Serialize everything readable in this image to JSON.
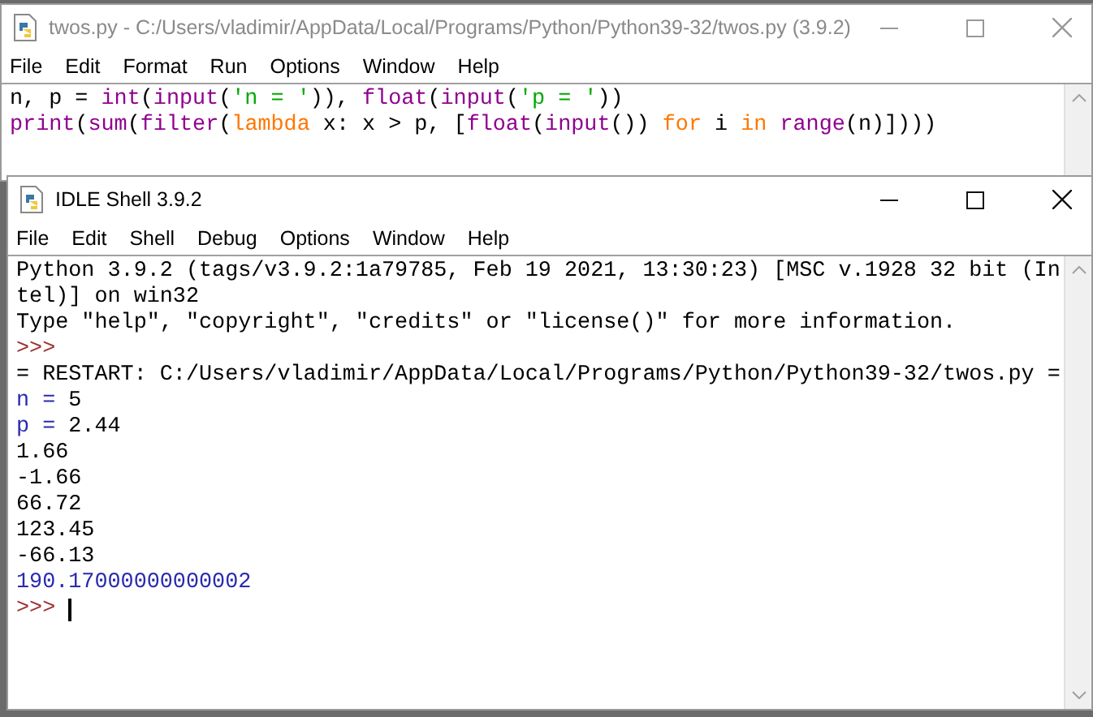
{
  "editor": {
    "title": "twos.py - C:/Users/vladimir/AppData/Local/Programs/Python/Python39-32/twos.py (3.9.2)",
    "active": false,
    "menu": [
      "File",
      "Edit",
      "Format",
      "Run",
      "Options",
      "Window",
      "Help"
    ],
    "lines": [
      [
        {
          "text": "n, p = ",
          "kind": "plain"
        },
        {
          "text": "int",
          "kind": "builtin"
        },
        {
          "text": "(",
          "kind": "plain"
        },
        {
          "text": "input",
          "kind": "builtin"
        },
        {
          "text": "(",
          "kind": "plain"
        },
        {
          "text": "'n = '",
          "kind": "string"
        },
        {
          "text": ")), ",
          "kind": "plain"
        },
        {
          "text": "float",
          "kind": "builtin"
        },
        {
          "text": "(",
          "kind": "plain"
        },
        {
          "text": "input",
          "kind": "builtin"
        },
        {
          "text": "(",
          "kind": "plain"
        },
        {
          "text": "'p = '",
          "kind": "string"
        },
        {
          "text": "))",
          "kind": "plain"
        }
      ],
      [
        {
          "text": "print",
          "kind": "builtin"
        },
        {
          "text": "(",
          "kind": "plain"
        },
        {
          "text": "sum",
          "kind": "builtin"
        },
        {
          "text": "(",
          "kind": "plain"
        },
        {
          "text": "filter",
          "kind": "builtin"
        },
        {
          "text": "(",
          "kind": "plain"
        },
        {
          "text": "lambda",
          "kind": "keyword"
        },
        {
          "text": " x: x > p, [",
          "kind": "plain"
        },
        {
          "text": "float",
          "kind": "builtin"
        },
        {
          "text": "(",
          "kind": "plain"
        },
        {
          "text": "input",
          "kind": "builtin"
        },
        {
          "text": "()) ",
          "kind": "plain"
        },
        {
          "text": "for",
          "kind": "keyword"
        },
        {
          "text": " i ",
          "kind": "plain"
        },
        {
          "text": "in",
          "kind": "keyword"
        },
        {
          "text": " range",
          "kind": "builtin"
        },
        {
          "text": "(n)])))",
          "kind": "plain"
        }
      ]
    ]
  },
  "shell": {
    "title": "IDLE Shell 3.9.2",
    "active": true,
    "menu": [
      "File",
      "Edit",
      "Shell",
      "Debug",
      "Options",
      "Window",
      "Help"
    ],
    "lines": [
      [
        {
          "text": "Python 3.9.2 (tags/v3.9.2:1a79785, Feb 19 2021, 13:30:23) [MSC v.1928 32 bit (In",
          "kind": "plain"
        }
      ],
      [
        {
          "text": "tel)] on win32",
          "kind": "plain"
        }
      ],
      [
        {
          "text": "Type \"help\", \"copyright\", \"credits\" or \"license()\" for more information.",
          "kind": "plain"
        }
      ],
      [
        {
          "text": ">>>",
          "kind": "prompt"
        }
      ],
      [
        {
          "text": "= RESTART: C:/Users/vladimir/AppData/Local/Programs/Python/Python39-32/twos.py =",
          "kind": "plain"
        }
      ],
      [
        {
          "text": "n = ",
          "kind": "stdout"
        },
        {
          "text": "5",
          "kind": "plain"
        }
      ],
      [
        {
          "text": "p = ",
          "kind": "stdout"
        },
        {
          "text": "2.44",
          "kind": "plain"
        }
      ],
      [
        {
          "text": "1.66",
          "kind": "plain"
        }
      ],
      [
        {
          "text": "-1.66",
          "kind": "plain"
        }
      ],
      [
        {
          "text": "66.72",
          "kind": "plain"
        }
      ],
      [
        {
          "text": "123.45",
          "kind": "plain"
        }
      ],
      [
        {
          "text": "-66.13",
          "kind": "plain"
        }
      ],
      [
        {
          "text": "190.17000000000002",
          "kind": "stdout"
        }
      ],
      [
        {
          "text": ">>> ",
          "kind": "prompt"
        }
      ]
    ]
  }
}
